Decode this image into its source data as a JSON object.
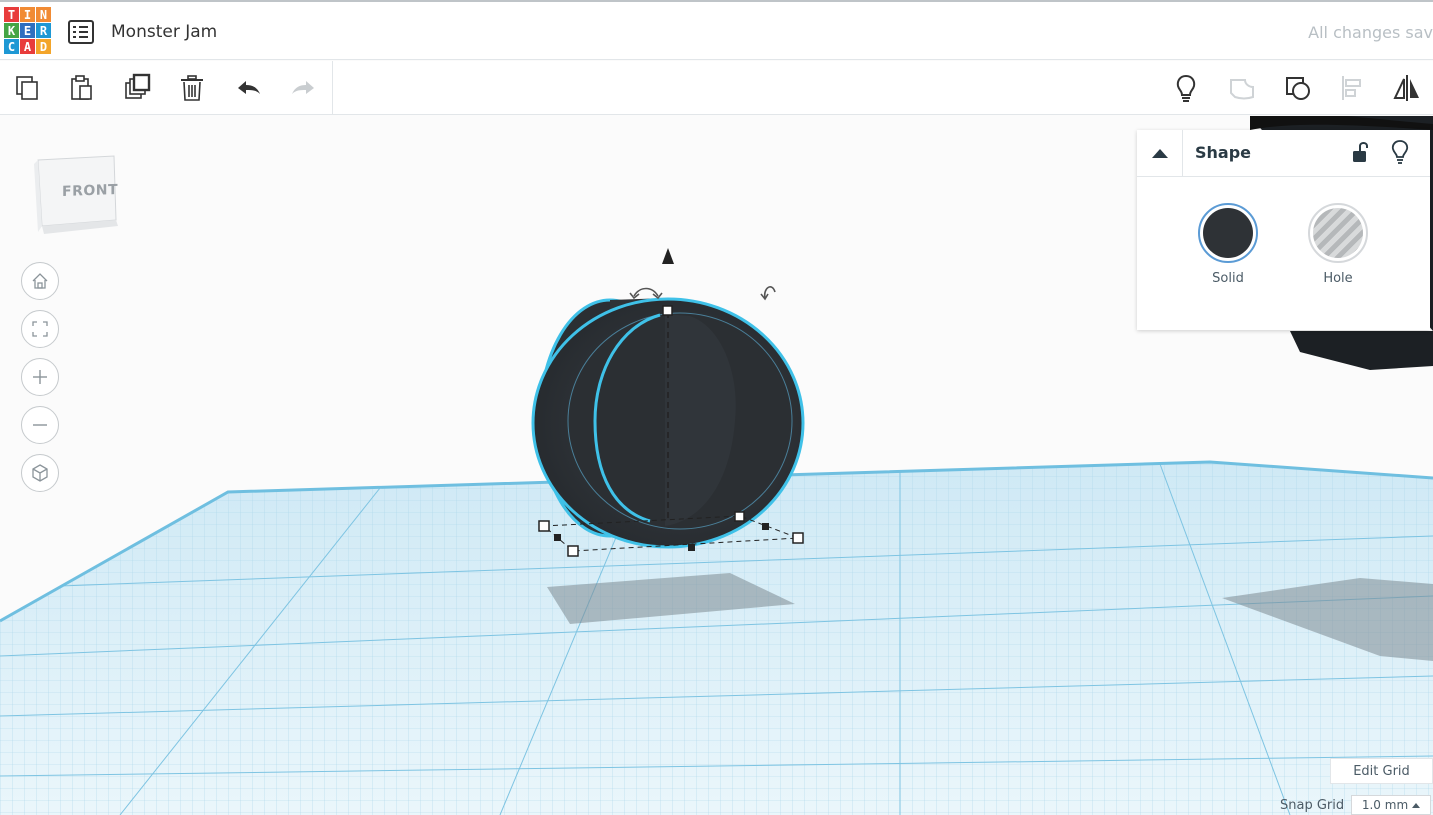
{
  "header": {
    "logo_letters": [
      "T",
      "I",
      "N",
      "K",
      "E",
      "R",
      "C",
      "A",
      "D"
    ],
    "project_title": "Monster Jam",
    "save_status": "All changes sav"
  },
  "toolbar": {
    "left_tools": [
      {
        "name": "copy-icon"
      },
      {
        "name": "paste-icon"
      },
      {
        "name": "duplicate-icon"
      },
      {
        "name": "delete-icon"
      },
      {
        "name": "undo-icon"
      },
      {
        "name": "redo-icon"
      }
    ],
    "right_tools": [
      {
        "name": "lightbulb-icon"
      },
      {
        "name": "group-icon"
      },
      {
        "name": "ungroup-icon"
      },
      {
        "name": "align-icon"
      },
      {
        "name": "mirror-icon"
      }
    ]
  },
  "view_cube": {
    "face_label": "FRONT"
  },
  "nav_controls": [
    "home-icon",
    "fit-view-icon",
    "zoom-in-icon",
    "zoom-out-icon",
    "perspective-icon"
  ],
  "shape_panel": {
    "title": "Shape",
    "solid_label": "Solid",
    "hole_label": "Hole",
    "solid_color": "#2e3236",
    "selected": "Solid"
  },
  "grid": {
    "edit_label": "Edit Grid",
    "snap_label": "Snap Grid",
    "snap_value": "1.0 mm"
  },
  "colors": {
    "accent": "#5b9bd5",
    "selection_outline": "#3fc1e8",
    "workplane": "#cfe9f5"
  }
}
